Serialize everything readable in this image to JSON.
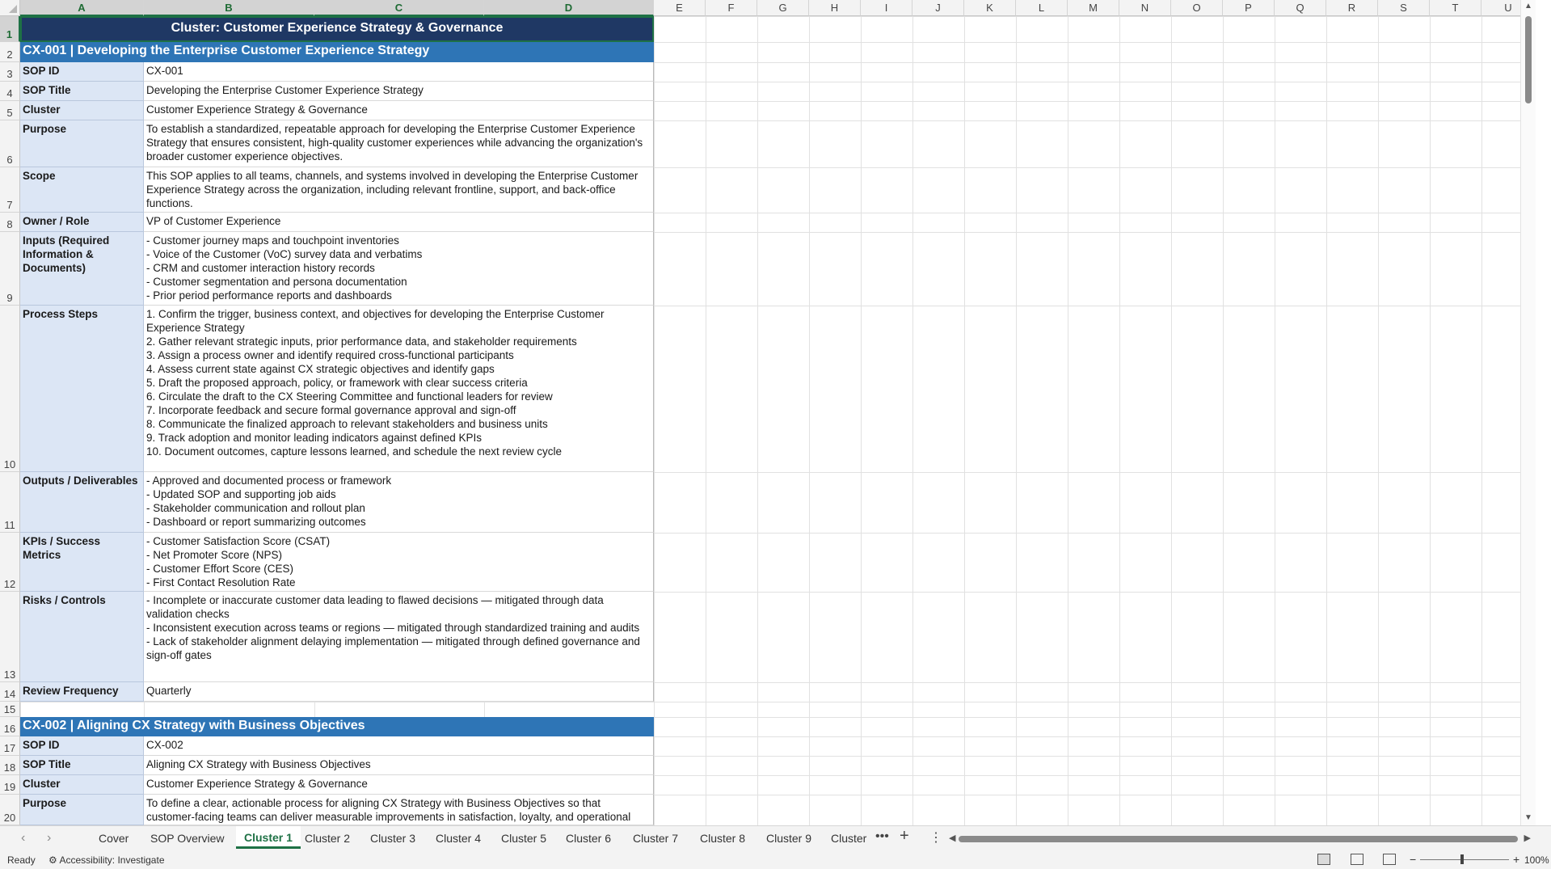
{
  "columns": [
    "A",
    "B",
    "C",
    "D",
    "E",
    "F",
    "G",
    "H",
    "I",
    "J",
    "K",
    "L",
    "M",
    "N",
    "O",
    "P",
    "Q",
    "R",
    "S",
    "T",
    "U"
  ],
  "rows": [
    "1",
    "2",
    "3",
    "4",
    "5",
    "6",
    "7",
    "8",
    "9",
    "10",
    "11",
    "12",
    "13",
    "14",
    "15",
    "16",
    "17",
    "18",
    "19",
    "20"
  ],
  "cluster_title": "Cluster: Customer Experience Strategy & Governance",
  "sop1": {
    "header": "CX-001  |  Developing the Enterprise Customer Experience Strategy",
    "fields": [
      {
        "label": "SOP ID",
        "value": "CX-001"
      },
      {
        "label": "SOP Title",
        "value": "Developing the Enterprise Customer Experience Strategy"
      },
      {
        "label": "Cluster",
        "value": "Customer Experience Strategy & Governance"
      },
      {
        "label": "Purpose",
        "value": "To establish a standardized, repeatable approach for developing the Enterprise Customer Experience Strategy that ensures consistent, high-quality customer experiences while advancing the organization's broader customer experience objectives."
      },
      {
        "label": "Scope",
        "value": "This SOP applies to all teams, channels, and systems involved in developing the Enterprise Customer Experience Strategy across the organization, including relevant frontline, support, and back-office functions."
      },
      {
        "label": "Owner / Role",
        "value": "VP of Customer Experience"
      },
      {
        "label": "Inputs (Required Information & Documents)",
        "value": "- Customer journey maps and touchpoint inventories\n- Voice of the Customer (VoC) survey data and verbatims\n- CRM and customer interaction history records\n- Customer segmentation and persona documentation\n- Prior period performance reports and dashboards"
      },
      {
        "label": "Process Steps",
        "value": "1. Confirm the trigger, business context, and objectives for developing the Enterprise Customer Experience Strategy\n2. Gather relevant strategic inputs, prior performance data, and stakeholder requirements\n3. Assign a process owner and identify required cross-functional participants\n4. Assess current state against CX strategic objectives and identify gaps\n5. Draft the proposed approach, policy, or framework with clear success criteria\n6. Circulate the draft to the CX Steering Committee and functional leaders for review\n7. Incorporate feedback and secure formal governance approval and sign-off\n8. Communicate the finalized approach to relevant stakeholders and business units\n9. Track adoption and monitor leading indicators against defined KPIs\n10. Document outcomes, capture lessons learned, and schedule the next review cycle"
      },
      {
        "label": "Outputs / Deliverables",
        "value": "- Approved and documented process or framework\n- Updated SOP and supporting job aids\n- Stakeholder communication and rollout plan\n- Dashboard or report summarizing outcomes"
      },
      {
        "label": "KPIs / Success Metrics",
        "value": "- Customer Satisfaction Score (CSAT)\n- Net Promoter Score (NPS)\n- Customer Effort Score (CES)\n- First Contact Resolution Rate"
      },
      {
        "label": "Risks / Controls",
        "value": "- Incomplete or inaccurate customer data leading to flawed decisions — mitigated through data validation checks\n- Inconsistent execution across teams or regions — mitigated through standardized training and audits\n- Lack of stakeholder alignment delaying implementation — mitigated through defined governance and sign-off gates"
      },
      {
        "label": "Review Frequency",
        "value": "Quarterly"
      }
    ]
  },
  "sop2": {
    "header": "CX-002  |  Aligning CX Strategy with Business Objectives",
    "fields": [
      {
        "label": "SOP ID",
        "value": "CX-002"
      },
      {
        "label": "SOP Title",
        "value": "Aligning CX Strategy with Business Objectives"
      },
      {
        "label": "Cluster",
        "value": "Customer Experience Strategy & Governance"
      },
      {
        "label": "Purpose",
        "value": "To define a clear, actionable process for aligning CX Strategy with Business Objectives so that customer-facing teams can deliver measurable improvements in satisfaction, loyalty, and operational performance."
      }
    ]
  },
  "tabs": [
    "Cover",
    "SOP Overview",
    "Cluster 1",
    "Cluster 2",
    "Cluster 3",
    "Cluster 4",
    "Cluster 5",
    "Cluster 6",
    "Cluster 7",
    "Cluster 8",
    "Cluster 9",
    "Cluster "
  ],
  "active_tab": "Cluster 1",
  "status": {
    "ready": "Ready",
    "accessibility": "Accessibility: Investigate",
    "zoom": "100%"
  },
  "colors": {
    "cluster_title_bg": "#1f3864",
    "sop_header_bg": "#2e75b6",
    "label_bg": "#dce6f5",
    "accent": "#1e7145"
  }
}
